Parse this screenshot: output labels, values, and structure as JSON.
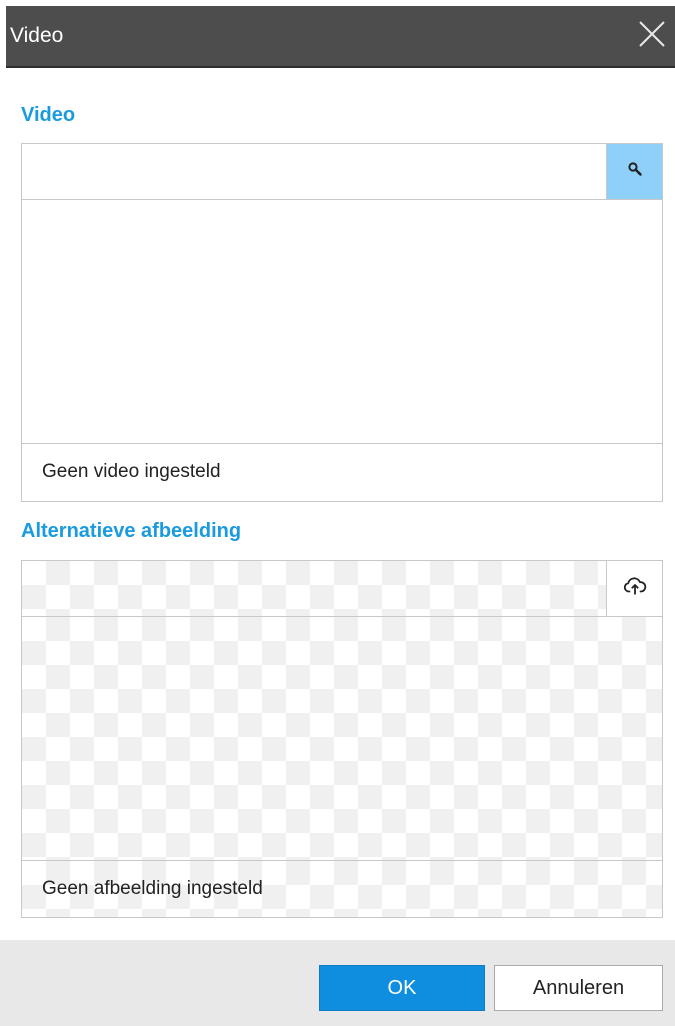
{
  "dialog": {
    "title": "Video",
    "close_icon": "close-icon"
  },
  "video_section": {
    "heading": "Video",
    "input_value": "",
    "search_icon": "search-icon",
    "status": "Geen video ingesteld"
  },
  "image_section": {
    "heading": "Alternatieve afbeelding",
    "upload_icon": "cloud-upload-icon",
    "status": "Geen afbeelding ingesteld"
  },
  "footer": {
    "ok_label": "OK",
    "cancel_label": "Annuleren"
  },
  "colors": {
    "accent": "#1a9be0",
    "ok_button": "#0f8ee0",
    "search_button": "#8fd0f8",
    "titlebar": "#4d4d4d"
  }
}
